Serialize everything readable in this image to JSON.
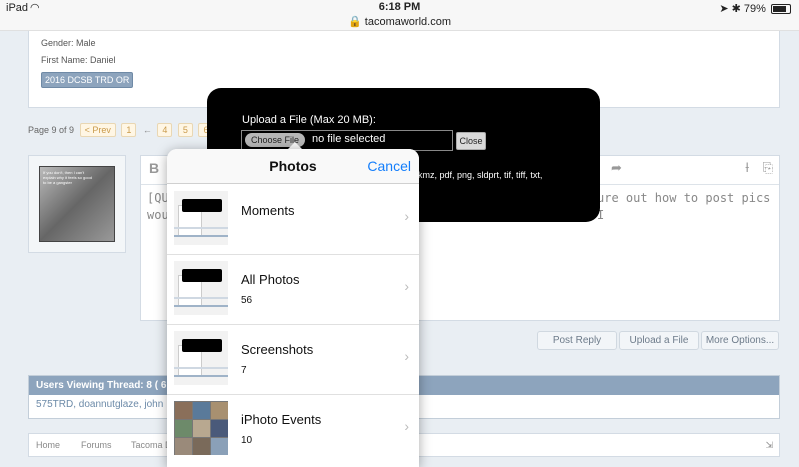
{
  "status_bar": {
    "device": "iPad",
    "time": "6:18 PM",
    "url": "tacomaworld.com",
    "battery": "79%"
  },
  "profile": {
    "gender_label": "Gender:",
    "gender_value": "Male",
    "first_name_label": "First Name:",
    "first_name_value": "Daniel",
    "badge": "2016 DCSB TRD OR"
  },
  "pagination": {
    "label": "Page 9 of 9",
    "prev": "< Prev",
    "pages": [
      "1",
      "4",
      "5",
      "6"
    ]
  },
  "avatar": {
    "caption": "If you don't, then I can't explain why it feels so good to be a gangster"
  },
  "editor": {
    "bold_label": "B",
    "text_left_1": "[QU",
    "text_left_2": "wou",
    "text_right": "ure out how to post pics I"
  },
  "actions": {
    "post_reply": "Post Reply",
    "upload_file": "Upload a File",
    "more_options": "More Options..."
  },
  "viewers": {
    "title": "Users Viewing Thread: 8 ( 6 (",
    "list": "575TRD, doannutglaze, john"
  },
  "breadcrumb": {
    "home": "Home",
    "forums": "Forums",
    "tacoma": "Tacoma D"
  },
  "upload_dialog": {
    "title": "Upload a File (Max 20 MB):",
    "choose_button": "Choose File",
    "no_file": "no file selected",
    "close_button": "Close",
    "extensions": "kmz, pdf, png, sldprt, tif, tiff, txt,"
  },
  "photos_picker": {
    "title": "Photos",
    "cancel": "Cancel",
    "albums": [
      {
        "name": "Moments",
        "count": ""
      },
      {
        "name": "All Photos",
        "count": "56"
      },
      {
        "name": "Screenshots",
        "count": "7"
      },
      {
        "name": "iPhoto Events",
        "count": "10"
      }
    ]
  }
}
